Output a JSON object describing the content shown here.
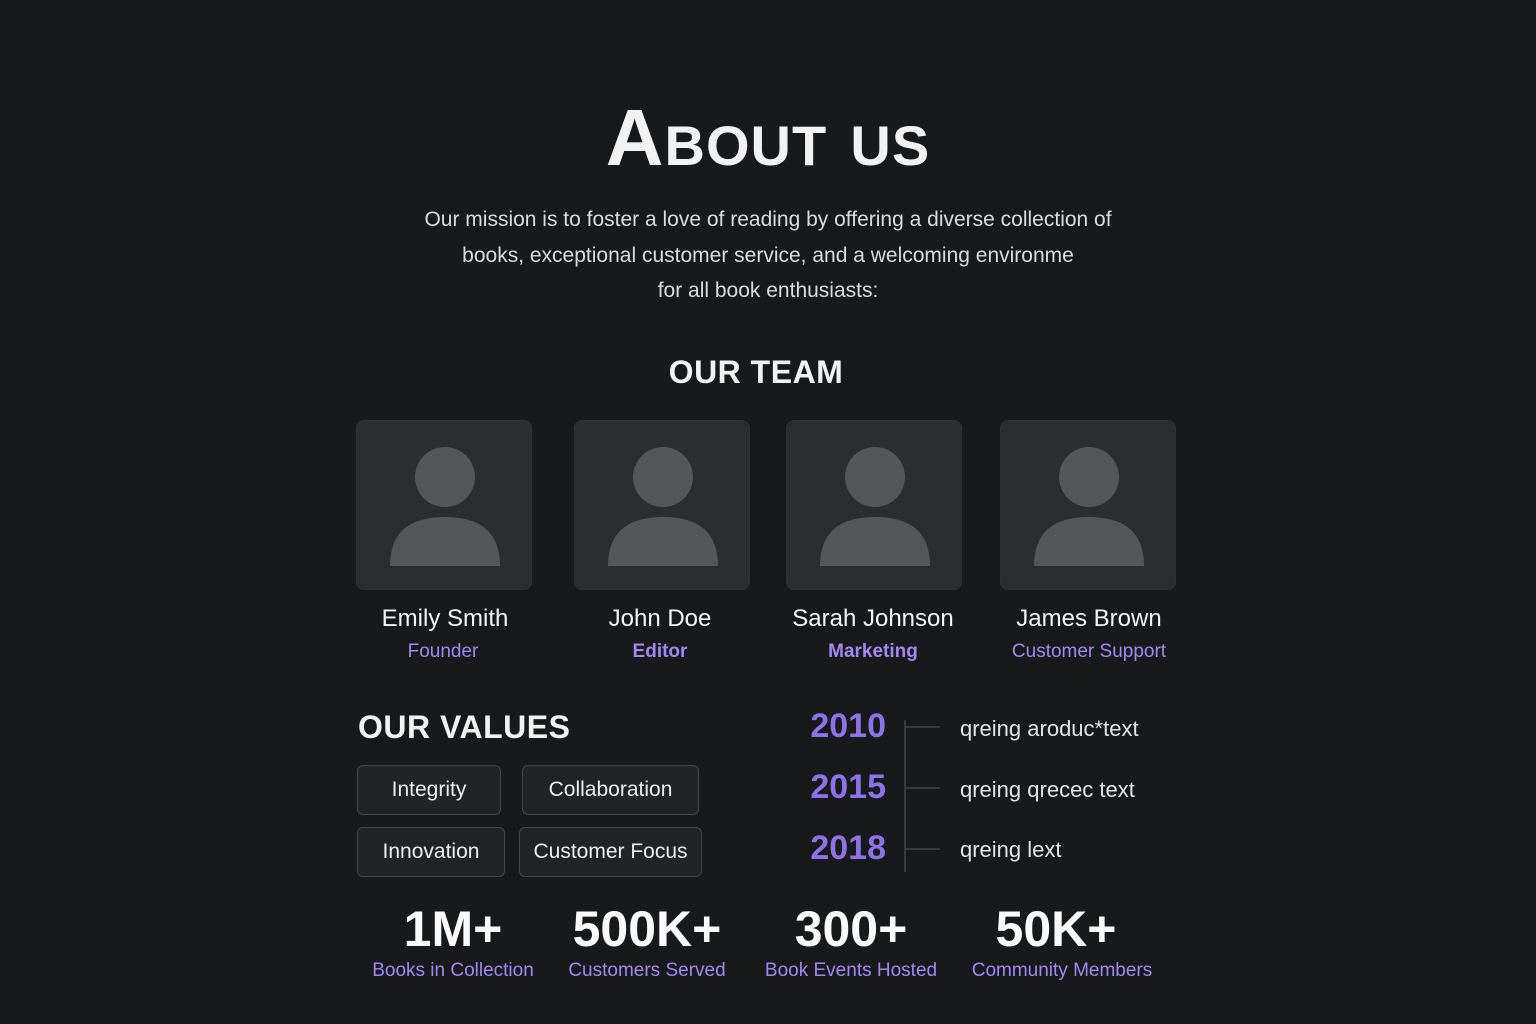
{
  "title": "About us",
  "mission": [
    "Our mission is to foster a love of reading by offering a diverse collection of",
    "books, exceptional customer service, and a welcoming environme",
    "for all book enthusiasts:"
  ],
  "team": {
    "heading": "OUR TEAM",
    "members": [
      {
        "name": "Emily Smith",
        "role": "Founder"
      },
      {
        "name": "John Doe",
        "role": "Editor"
      },
      {
        "name": "Sarah Johnson",
        "role": "Marketing"
      },
      {
        "name": "James Brown",
        "role": "Customer Support"
      }
    ]
  },
  "values": {
    "heading": "OUR VALUES",
    "items": [
      "Integrity",
      "Collaboration",
      "Innovation",
      "Customer Focus"
    ]
  },
  "timeline": [
    {
      "year": "2010",
      "text": "qreing aroduc*text"
    },
    {
      "year": "2015",
      "text": "qreing qrecec text"
    },
    {
      "year": "2018",
      "text": "qreing lext"
    }
  ],
  "stats": [
    {
      "value": "1M+",
      "label": "Books in Collection"
    },
    {
      "value": "500K+",
      "label": "Customers Served"
    },
    {
      "value": "300+",
      "label": "Book Events Hosted"
    },
    {
      "value": "50K+",
      "label": "Community Members"
    }
  ],
  "colors": {
    "accent": "#a586f5",
    "background": "#18191b"
  }
}
